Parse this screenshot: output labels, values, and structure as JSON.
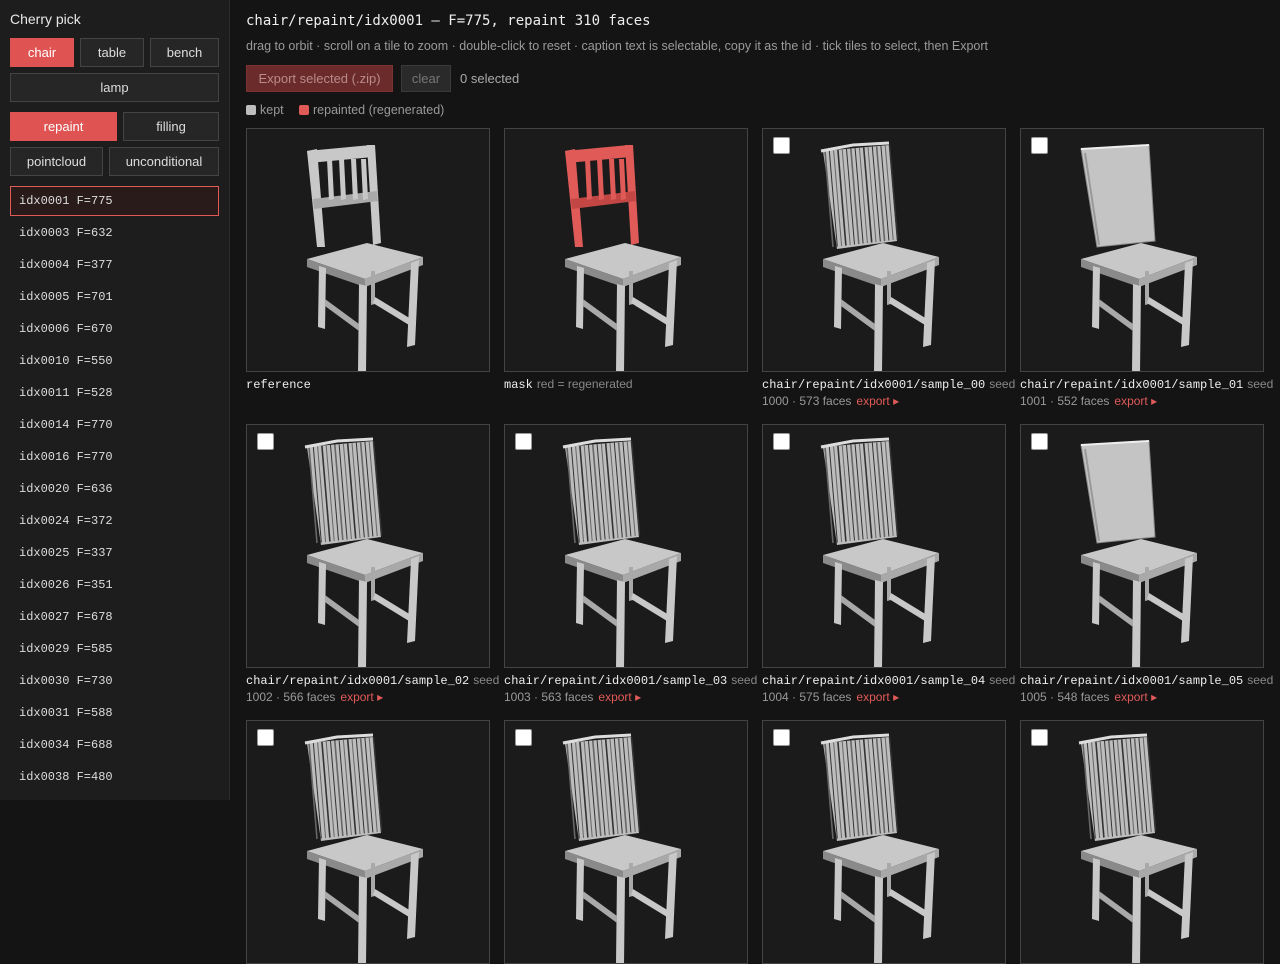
{
  "sidebar": {
    "title": "Cherry pick",
    "categories": [
      "chair",
      "table",
      "bench",
      "lamp"
    ],
    "active_category": "chair",
    "modes": [
      "repaint",
      "filling",
      "pointcloud",
      "unconditional"
    ],
    "active_mode": "repaint",
    "items": [
      "idx0001 F=775",
      "idx0003 F=632",
      "idx0004 F=377",
      "idx0005 F=701",
      "idx0006 F=670",
      "idx0010 F=550",
      "idx0011 F=528",
      "idx0014 F=770",
      "idx0016 F=770",
      "idx0020 F=636",
      "idx0024 F=372",
      "idx0025 F=337",
      "idx0026 F=351",
      "idx0027 F=678",
      "idx0029 F=585",
      "idx0030 F=730",
      "idx0031 F=588",
      "idx0034 F=688",
      "idx0038 F=480"
    ],
    "selected_item": "idx0001 F=775"
  },
  "header": {
    "title": "chair/repaint/idx0001 — F=775, repaint 310 faces",
    "subtitle": "drag to orbit · scroll on a tile to zoom · double-click to reset · caption text is selectable, copy it as the id · tick tiles to select, then Export"
  },
  "toolbar": {
    "export_label": "Export selected (.zip)",
    "clear_label": "clear",
    "selected_count": "0 selected"
  },
  "legend": {
    "kept_label": "kept",
    "kept_color": "#bdbdbd",
    "repainted_label": "repainted (regenerated)",
    "repainted_color": "#e05a58"
  },
  "tiles": [
    {
      "id": "reference",
      "tag": "",
      "line2": "",
      "export": "",
      "checkbox": false,
      "kind": "reference"
    },
    {
      "id": "mask",
      "tag": "red = regenerated",
      "line2": "",
      "export": "",
      "checkbox": false,
      "kind": "mask"
    },
    {
      "id": "chair/repaint/idx0001/sample_00",
      "tag": "seed",
      "line2": "1000 · 573 faces",
      "export": "export ▸",
      "checkbox": true,
      "kind": "noisy"
    },
    {
      "id": "chair/repaint/idx0001/sample_01",
      "tag": "seed",
      "line2": "1001 · 552 faces",
      "export": "export ▸",
      "checkbox": true,
      "kind": "panel"
    },
    {
      "id": "chair/repaint/idx0001/sample_02",
      "tag": "seed",
      "line2": "1002 · 566 faces",
      "export": "export ▸",
      "checkbox": true,
      "kind": "noisy"
    },
    {
      "id": "chair/repaint/idx0001/sample_03",
      "tag": "seed",
      "line2": "1003 · 563 faces",
      "export": "export ▸",
      "checkbox": true,
      "kind": "noisy"
    },
    {
      "id": "chair/repaint/idx0001/sample_04",
      "tag": "seed",
      "line2": "1004 · 575 faces",
      "export": "export ▸",
      "checkbox": true,
      "kind": "noisy"
    },
    {
      "id": "chair/repaint/idx0001/sample_05",
      "tag": "seed",
      "line2": "1005 · 548 faces",
      "export": "export ▸",
      "checkbox": true,
      "kind": "panel"
    },
    {
      "id": "",
      "tag": "",
      "line2": "",
      "export": "",
      "checkbox": true,
      "kind": "noisy"
    },
    {
      "id": "",
      "tag": "",
      "line2": "",
      "export": "",
      "checkbox": true,
      "kind": "noisy"
    },
    {
      "id": "",
      "tag": "",
      "line2": "",
      "export": "",
      "checkbox": true,
      "kind": "noisy"
    },
    {
      "id": "",
      "tag": "",
      "line2": "",
      "export": "",
      "checkbox": true,
      "kind": "noisy"
    }
  ]
}
